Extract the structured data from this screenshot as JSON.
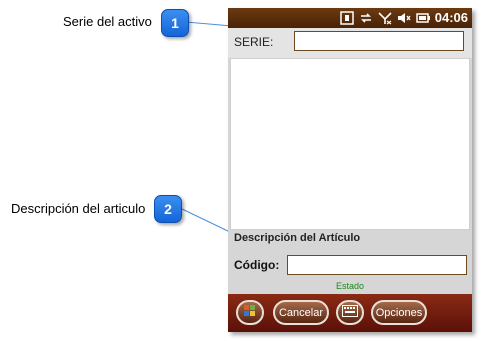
{
  "callouts": [
    {
      "number": "1",
      "label": "Serie del activo"
    },
    {
      "number": "2",
      "label": "Descripción del articulo"
    }
  ],
  "status_bar": {
    "time": "04:06",
    "icons": [
      "sync-icon",
      "connectivity-icon",
      "no-signal-icon",
      "speaker-muted-icon",
      "battery-icon"
    ]
  },
  "form": {
    "serie_label": "SERIE:",
    "serie_value": "",
    "description_title": "Descripción del Artículo",
    "codigo_label": "Código:",
    "codigo_value": "",
    "status_text": "Estado"
  },
  "softkeys": {
    "start": "windows-start-icon",
    "cancel_label": "Cancelar",
    "keyboard": "keyboard-icon",
    "options_label": "Opciones"
  },
  "colors": {
    "callout_badge": "#1e73e0",
    "status_bar": "#5a2c0b",
    "softbar": "#7a1f10",
    "status_text": "#1a8a1a"
  }
}
